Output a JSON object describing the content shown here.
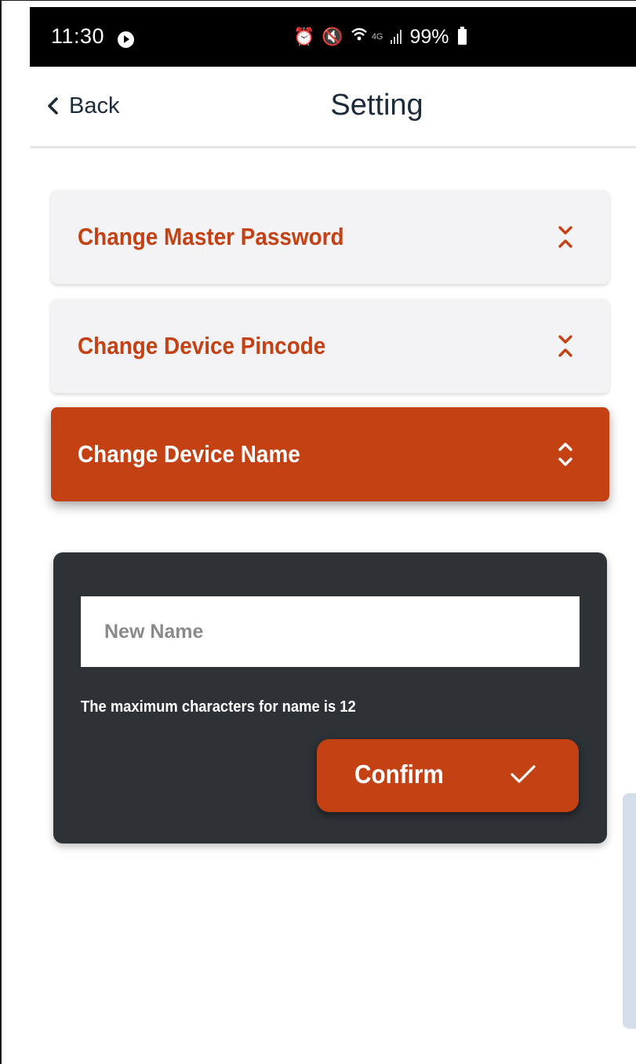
{
  "status_bar": {
    "time": "11:30",
    "battery_percent": "99%",
    "network_label": "4G",
    "icons": [
      "play-icon",
      "alarm-icon",
      "mute-icon",
      "wifi-icon",
      "signal-icon",
      "battery-icon"
    ]
  },
  "header": {
    "back_label": "Back",
    "title": "Setting"
  },
  "accordion": {
    "items": [
      {
        "label": "Change Master Password",
        "state": "collapsed",
        "icon": "expand-icon"
      },
      {
        "label": "Change Device Pincode",
        "state": "collapsed",
        "icon": "expand-icon"
      },
      {
        "label": "Change Device Name",
        "state": "expanded",
        "icon": "collapse-icon"
      }
    ]
  },
  "device_name_form": {
    "input_value": "",
    "input_placeholder": "New Name",
    "hint": "The maximum characters for name is 12",
    "confirm_label": "Confirm"
  },
  "colors": {
    "accent": "#c44113",
    "panel_bg": "#2d3237",
    "collapsed_bg": "#f3f3f5",
    "title_text": "#1c2a3a",
    "status_bar_bg": "#000000"
  }
}
